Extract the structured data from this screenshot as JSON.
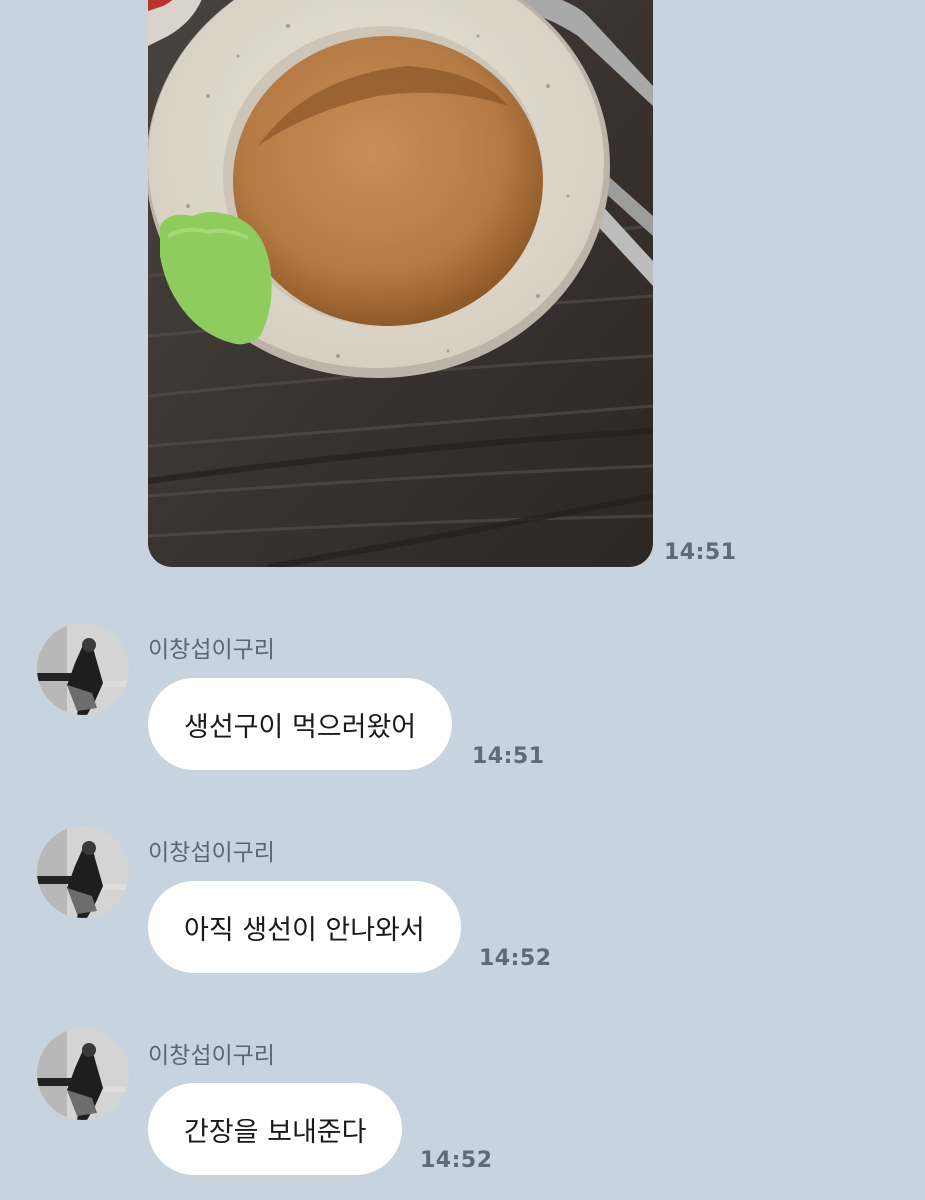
{
  "photo_message": {
    "image_icon": "photo-soy-sauce-wasabi",
    "time": "14:51"
  },
  "messages": [
    {
      "sender": "이창섭이구리",
      "avatar_icon": "profile-photo",
      "text": "생선구이 먹으러왔어",
      "time": "14:51"
    },
    {
      "sender": "이창섭이구리",
      "avatar_icon": "profile-photo",
      "text": "아직 생선이 안나와서",
      "time": "14:52"
    },
    {
      "sender": "이창섭이구리",
      "avatar_icon": "profile-photo",
      "text": "간장을 보내준다",
      "time": "14:52"
    }
  ],
  "colors": {
    "chat_background": "#c7d3df",
    "bubble": "#ffffff",
    "time_text": "#5f6a75"
  }
}
